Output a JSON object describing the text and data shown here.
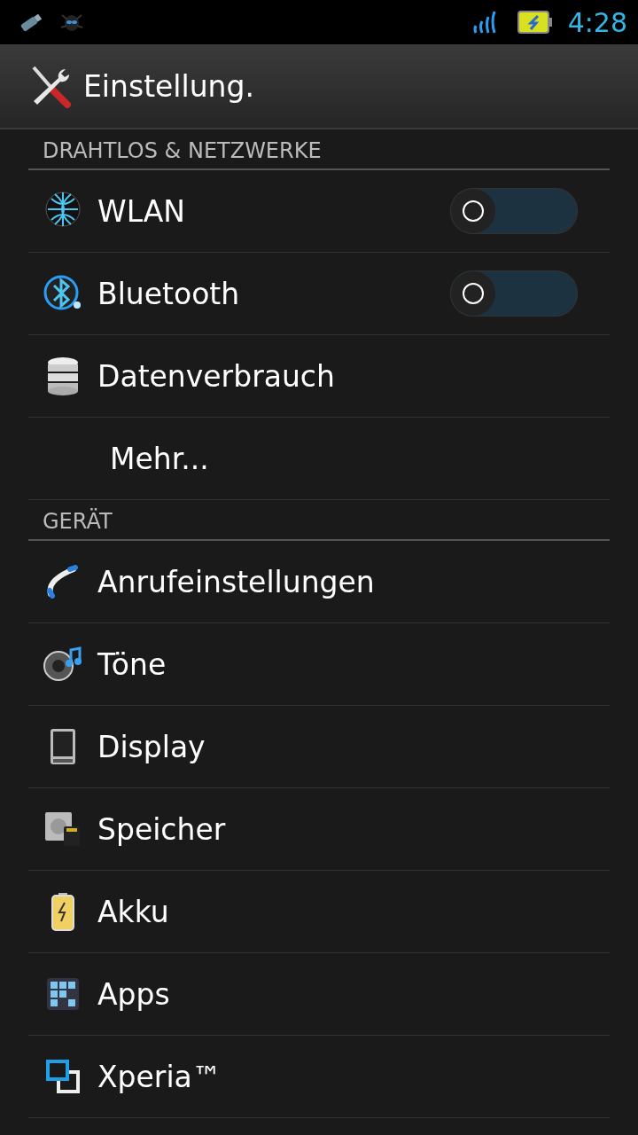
{
  "status_bar": {
    "time": "4:28"
  },
  "action_bar": {
    "title": "Einstellung."
  },
  "sections": [
    {
      "header": "DRAHTLOS & NETZWERKE",
      "items": [
        {
          "label": "WLAN",
          "kind": "switch",
          "on": false
        },
        {
          "label": "Bluetooth",
          "kind": "switch",
          "on": false
        },
        {
          "label": "Datenverbrauch",
          "kind": "plain"
        },
        {
          "label": "Mehr...",
          "kind": "plain"
        }
      ]
    },
    {
      "header": "GERÄT",
      "items": [
        {
          "label": "Anrufeinstellungen",
          "kind": "plain"
        },
        {
          "label": "Töne",
          "kind": "plain"
        },
        {
          "label": "Display",
          "kind": "plain"
        },
        {
          "label": "Speicher",
          "kind": "plain"
        },
        {
          "label": "Akku",
          "kind": "plain"
        },
        {
          "label": "Apps",
          "kind": "plain"
        },
        {
          "label": "Xperia™",
          "kind": "plain"
        }
      ]
    }
  ]
}
